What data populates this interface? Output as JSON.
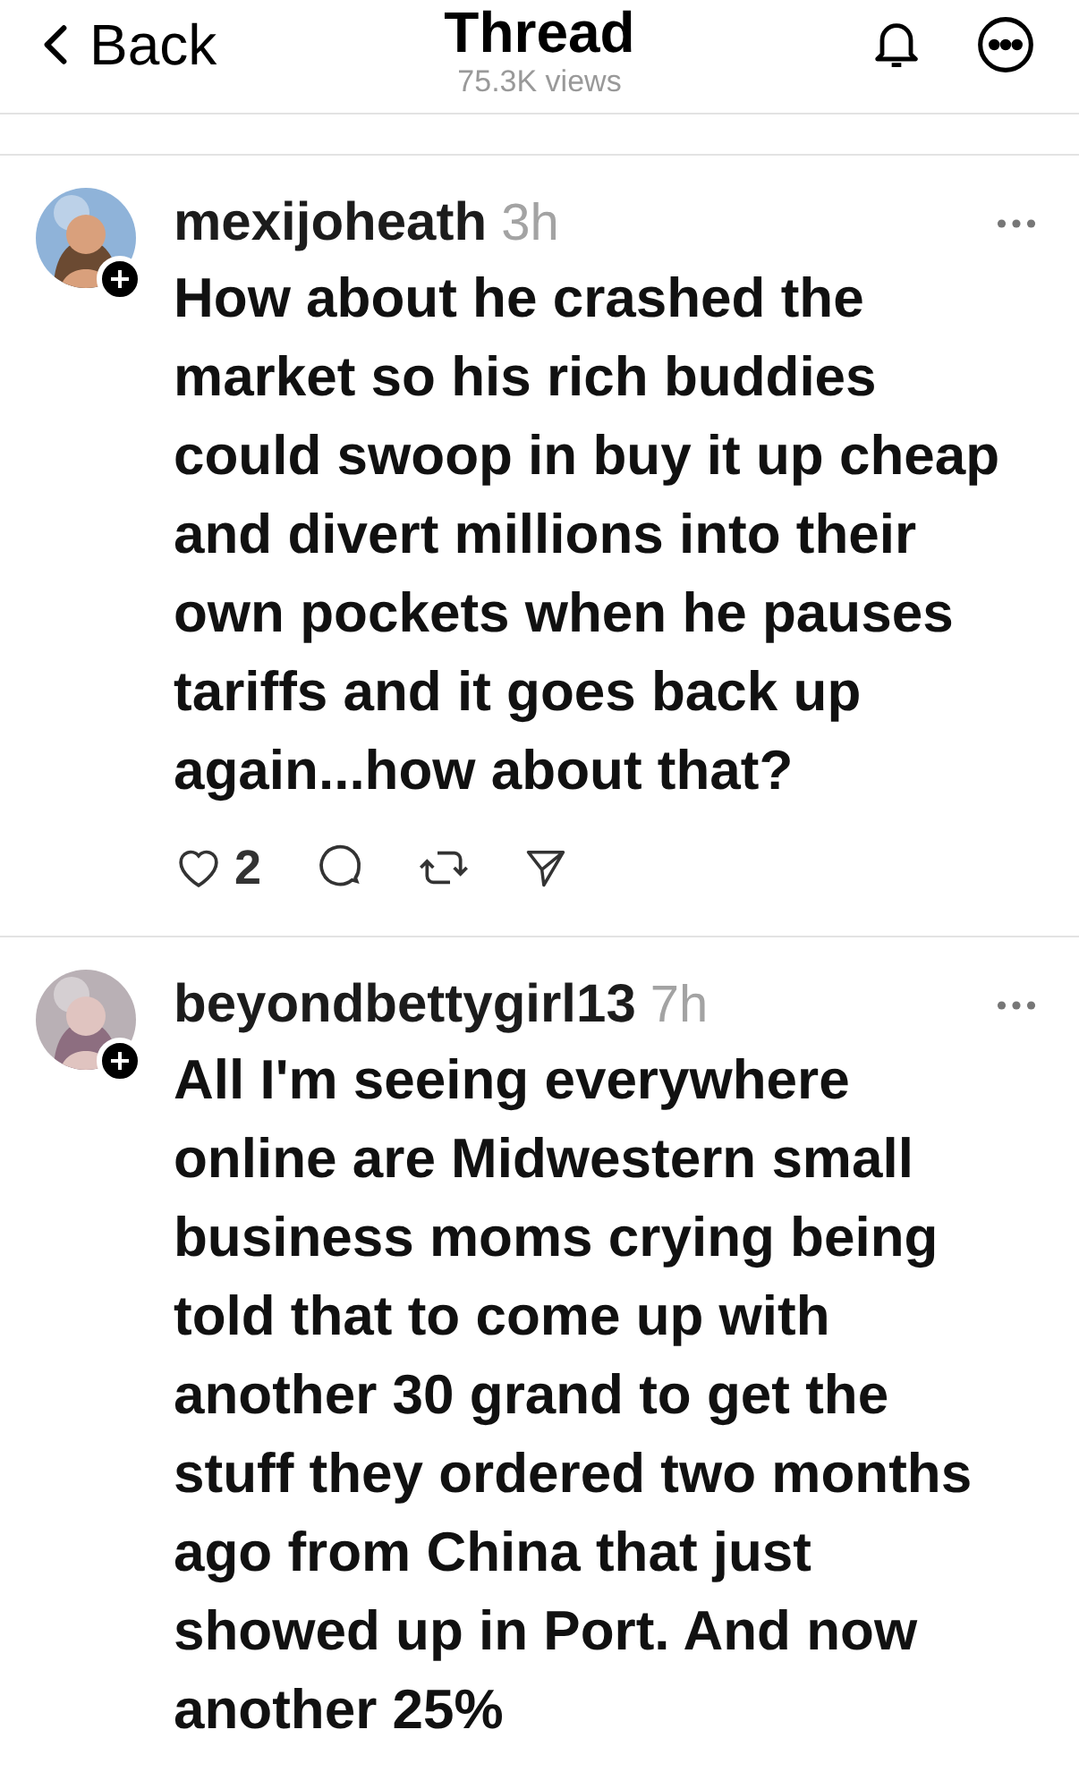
{
  "header": {
    "back": "Back",
    "title": "Thread",
    "views": "75.3K views"
  },
  "posts": [
    {
      "username": "mexijoheath",
      "time": "3h",
      "text": "How about he crashed the market so his rich buddies could swoop in buy it up cheap and divert millions into their own pockets when he pauses tariffs and it goes back up again...how about that?",
      "likes": "2"
    },
    {
      "username": "beyondbettygirl13",
      "time": "7h",
      "text": "All I'm seeing everywhere online are Midwestern small business moms crying being told that to come up with another 30 grand to get the stuff they ordered two months ago from China that just showed up in Port. And now another 25%"
    }
  ]
}
